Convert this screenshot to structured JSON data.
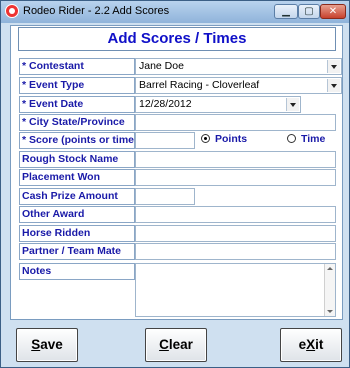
{
  "window": {
    "title": "Rodeo Rider  -  2.2   Add Scores",
    "minimize_glyph": "▁",
    "maximize_glyph": "▢",
    "close_glyph": "✕"
  },
  "form": {
    "header": "Add Scores / Times",
    "labels": {
      "contestant": "* Contestant",
      "event_type": "* Event Type",
      "event_date": "* Event Date",
      "city_state": "* City  State/Province",
      "score": "* Score (points or time)",
      "rough_stock": "Rough Stock Name",
      "placement": "Placement Won",
      "cash_prize": "Cash Prize Amount",
      "other_award": "Other Award",
      "horse": "Horse Ridden",
      "partner": "Partner / Team Mate",
      "notes": "Notes"
    },
    "values": {
      "contestant": "Jane Doe",
      "event_type": "Barrel Racing - Cloverleaf",
      "event_date": "12/28/2012",
      "city_state": "",
      "score": "",
      "rough_stock": "",
      "placement": "",
      "cash_prize": "",
      "other_award": "",
      "horse": "",
      "partner": "",
      "notes": ""
    },
    "score_mode": {
      "points_label": "Points",
      "time_label": "Time",
      "selected": "Points"
    }
  },
  "buttons": {
    "save": {
      "accel": "S",
      "rest": "ave"
    },
    "clear": {
      "accel": "C",
      "rest": "lear"
    },
    "exit": {
      "pre": "e",
      "accel": "X",
      "rest": "it"
    }
  }
}
